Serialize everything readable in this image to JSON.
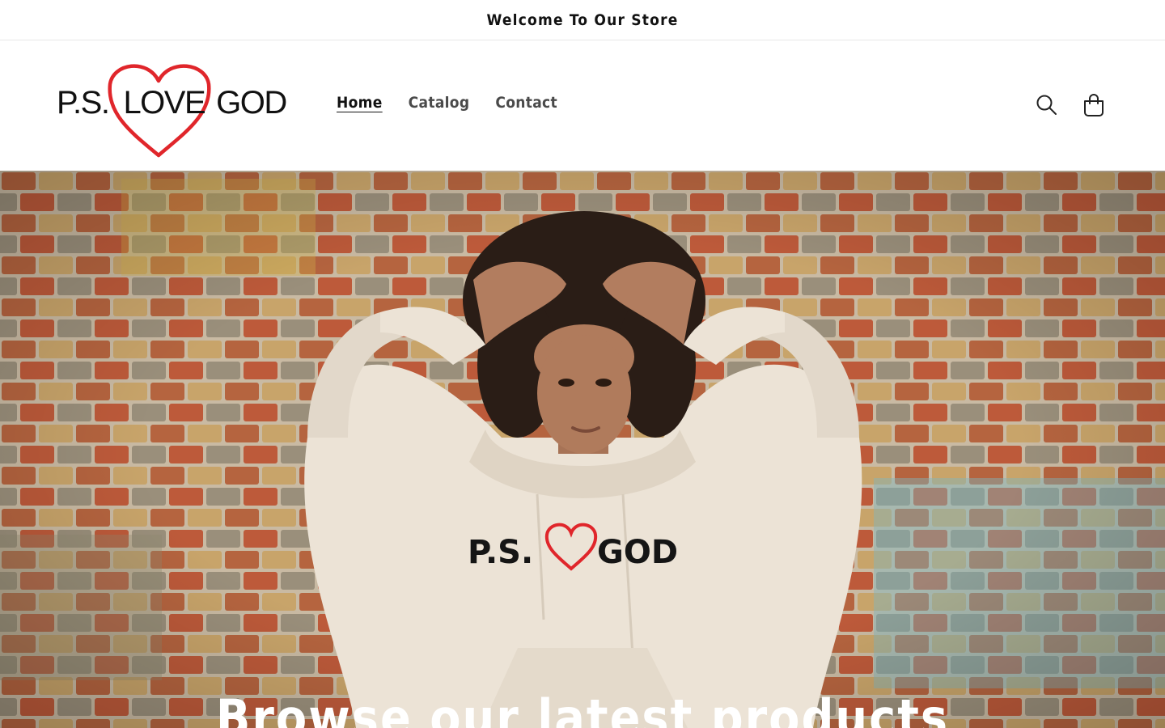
{
  "announcement": {
    "text": "Welcome To Our Store"
  },
  "header": {
    "logo": {
      "word1": "P.S.",
      "word2": "LOVE",
      "word3": "GOD",
      "heart_color": "#e0262b"
    },
    "nav": [
      {
        "label": "Home",
        "active": true
      },
      {
        "label": "Catalog",
        "active": false
      },
      {
        "label": "Contact",
        "active": false
      }
    ],
    "icons": {
      "search": "search-icon",
      "cart": "cart-icon"
    }
  },
  "hero": {
    "hoodie_print": {
      "left": "P.S.",
      "right": "GOD",
      "heart_color": "#e0262b"
    },
    "heading": "Browse our latest products"
  }
}
